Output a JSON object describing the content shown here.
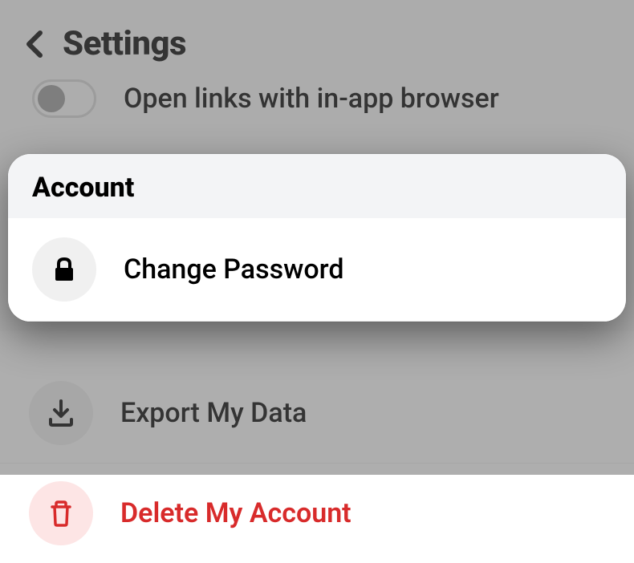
{
  "header": {
    "title": "Settings"
  },
  "toggle_row": {
    "label": "Open links with in-app browser"
  },
  "section": {
    "title": "Account",
    "items": [
      {
        "label": "Change Password"
      },
      {
        "label": "Export My Data"
      },
      {
        "label": "Delete My Account"
      }
    ]
  }
}
